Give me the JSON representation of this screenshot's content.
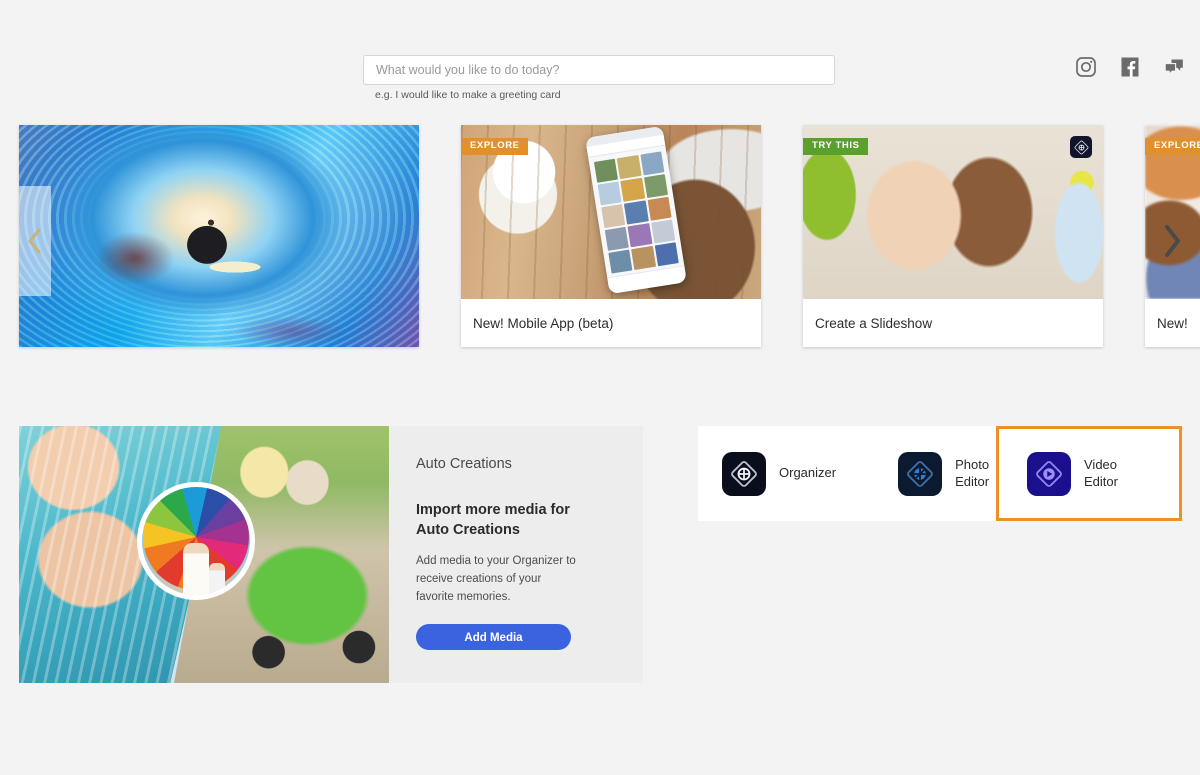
{
  "search": {
    "placeholder": "What would you like to do today?",
    "value": "",
    "hint": "e.g. I would like to make a greeting card"
  },
  "social": {
    "instagram": "instagram-icon",
    "facebook": "facebook-icon",
    "feedback": "chat-bubbles-icon"
  },
  "carousel": {
    "prev_label": "‹",
    "next_label": "›",
    "cards": [
      {
        "badge": "",
        "caption": "",
        "image": "surfer-in-wave"
      },
      {
        "badge": "EXPLORE",
        "caption": "New! Mobile App (beta)",
        "image": "hand-holding-phone-with-coffee"
      },
      {
        "badge": "TRY THIS",
        "caption": "Create a Slideshow",
        "image": "three-smiling-children"
      },
      {
        "badge": "EXPLORE",
        "caption": "New!",
        "image": "blurred-room-scene"
      }
    ]
  },
  "auto_creations": {
    "title": "Auto Creations",
    "heading": "Import more media for Auto Creations",
    "body": "Add media to your Organizer to receive creations of your favorite memories.",
    "button": "Add Media",
    "image": "photo-collage-kids-pool-beach-umbrella"
  },
  "launcher": {
    "apps": [
      {
        "label": "Organizer",
        "icon": "organizer-app-icon",
        "selected": false
      },
      {
        "label": "Photo\nEditor",
        "label_line1": "Photo",
        "label_line2": "Editor",
        "icon": "photo-editor-app-icon",
        "selected": false
      },
      {
        "label": "Video\nEditor",
        "label_line1": "Video",
        "label_line2": "Editor",
        "icon": "video-editor-app-icon",
        "selected": true
      }
    ]
  },
  "colors": {
    "page_background": "#f3f3f3",
    "badge_explore": "#e0902f",
    "badge_try_this": "#5aa02c",
    "primary_button": "#3b63e0",
    "selection_highlight": "#eb9126",
    "organizer_icon": "#0a0e1c",
    "photo_editor_icon": "#0b1a2e",
    "video_editor_icon": "#1a0f8c"
  }
}
